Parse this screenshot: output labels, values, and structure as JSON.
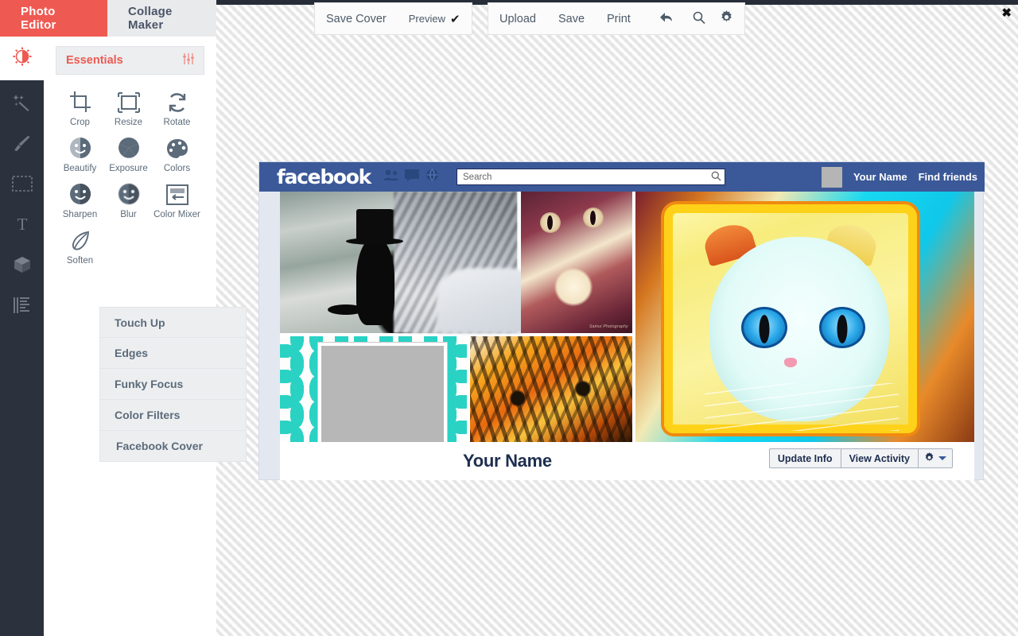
{
  "tabs": [
    {
      "label": "Photo Editor",
      "active": true
    },
    {
      "label": "Collage Maker",
      "active": false
    }
  ],
  "rail": {
    "items": [
      {
        "name": "edit-adjust-icon",
        "label": "Edit"
      },
      {
        "name": "magic-wand-icon",
        "label": "Effects"
      },
      {
        "name": "brush-icon",
        "label": "Brush"
      },
      {
        "name": "frame-icon",
        "label": "Frames"
      },
      {
        "name": "text-icon",
        "label": "Text"
      },
      {
        "name": "sticker-cube-icon",
        "label": "Stickers"
      },
      {
        "name": "texture-icon",
        "label": "Textures"
      }
    ]
  },
  "panel": {
    "header": "Essentials",
    "header_icon": "sliders-icon",
    "tools": [
      {
        "label": "Crop",
        "icon": "crop-icon"
      },
      {
        "label": "Resize",
        "icon": "resize-icon"
      },
      {
        "label": "Rotate",
        "icon": "rotate-icon"
      },
      {
        "label": "Beautify",
        "icon": "beautify-icon"
      },
      {
        "label": "Exposure",
        "icon": "exposure-icon"
      },
      {
        "label": "Colors",
        "icon": "palette-icon"
      },
      {
        "label": "Sharpen",
        "icon": "sharpen-icon"
      },
      {
        "label": "Blur",
        "icon": "blur-icon"
      },
      {
        "label": "Color Mixer",
        "icon": "color-mixer-icon"
      },
      {
        "label": "Soften",
        "icon": "soften-feather-icon"
      }
    ],
    "sections": [
      {
        "label": "Touch Up"
      },
      {
        "label": "Edges"
      },
      {
        "label": "Funky Focus"
      },
      {
        "label": "Color Filters"
      },
      {
        "label": "Facebook Cover"
      }
    ]
  },
  "toolbar": {
    "save_cover": "Save Cover",
    "preview": "Preview",
    "preview_checked": "✔",
    "upload": "Upload",
    "save": "Save",
    "print": "Print",
    "undo_icon": "undo-arrow-icon",
    "zoom_icon": "magnifier-icon",
    "settings_icon": "gear-icon",
    "close": "✖"
  },
  "canvas": {
    "facebook": {
      "logo": "facebook",
      "nav_icons": [
        "friend-requests-icon",
        "messages-icon",
        "globe-notifications-icon"
      ],
      "search_placeholder": "Search",
      "search_icon": "search-icon",
      "user_name": "Your Name",
      "find_friends": "Find friends"
    },
    "profile": {
      "name": "Your Name",
      "buttons": [
        {
          "label": "Update Info"
        },
        {
          "label": "View Activity"
        }
      ],
      "gear_icon": "gear-icon",
      "caret_icon": "chevron-down-icon"
    },
    "cover_photos": [
      {
        "name": "black-cat-top-hat",
        "caption": ""
      },
      {
        "name": "surprised-kitten",
        "caption": "Samui Photography"
      },
      {
        "name": "teal-petal-pattern",
        "caption": ""
      },
      {
        "name": "two-orange-tabby-kittens",
        "caption": ""
      },
      {
        "name": "white-cat-in-toast",
        "caption": ""
      }
    ]
  },
  "colors": {
    "accent": "#ee5a52",
    "rail": "#2b323d",
    "facebook_blue": "#3b5998",
    "panel_gray": "#eceef0",
    "teal": "#2ad2c4"
  }
}
